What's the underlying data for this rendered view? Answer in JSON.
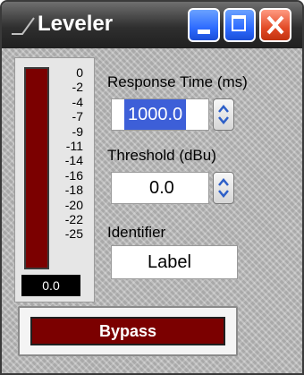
{
  "window": {
    "title": "Leveler"
  },
  "meter": {
    "scale": [
      "0",
      "-2",
      "-4",
      "-7",
      "-9",
      "-11",
      "-14",
      "-16",
      "-18",
      "-20",
      "-22",
      "-25"
    ],
    "readout": "0.0"
  },
  "response_time": {
    "label": "Response Time (ms)",
    "value": "1000.0"
  },
  "threshold": {
    "label": "Threshold (dBu)",
    "value": "0.0"
  },
  "identifier": {
    "label": "Identifier",
    "value": "Label"
  },
  "bypass": {
    "label": "Bypass"
  },
  "colors": {
    "meter": "#7b0000",
    "accent": "#2d6bff",
    "close": "#e24a26"
  }
}
